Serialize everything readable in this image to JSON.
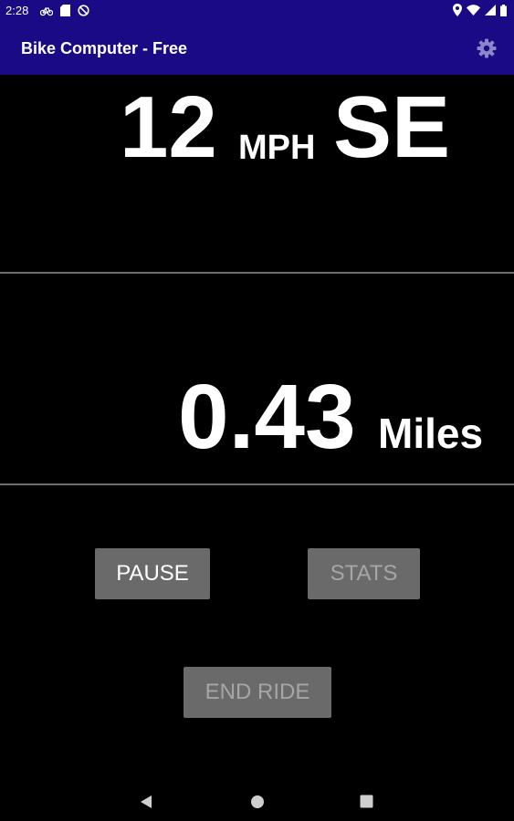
{
  "status_bar": {
    "time": "2:28",
    "left_icons": [
      "bike-icon",
      "sd-card-icon",
      "no-disturb-icon"
    ],
    "right_icons": [
      "location-icon",
      "wifi-icon",
      "signal-icon",
      "battery-icon"
    ]
  },
  "app_bar": {
    "title": "Bike Computer - Free",
    "settings_icon": "gear-icon"
  },
  "speed": {
    "value": "12",
    "unit": "MPH",
    "heading": "SE"
  },
  "distance": {
    "value": "0.43",
    "unit": "Miles"
  },
  "buttons": {
    "pause": "PAUSE",
    "stats": "STATS",
    "end_ride": "END RIDE"
  },
  "nav_bar": {
    "back_icon": "back-icon",
    "home_icon": "home-icon",
    "recents_icon": "recents-icon"
  },
  "colors": {
    "app_bar": "#1a0a85",
    "background": "#000000",
    "button": "#6a6a6a",
    "button_text_enabled": "#ffffff",
    "button_text_disabled": "#a6a6a6",
    "divider": "#6e6e6e"
  }
}
